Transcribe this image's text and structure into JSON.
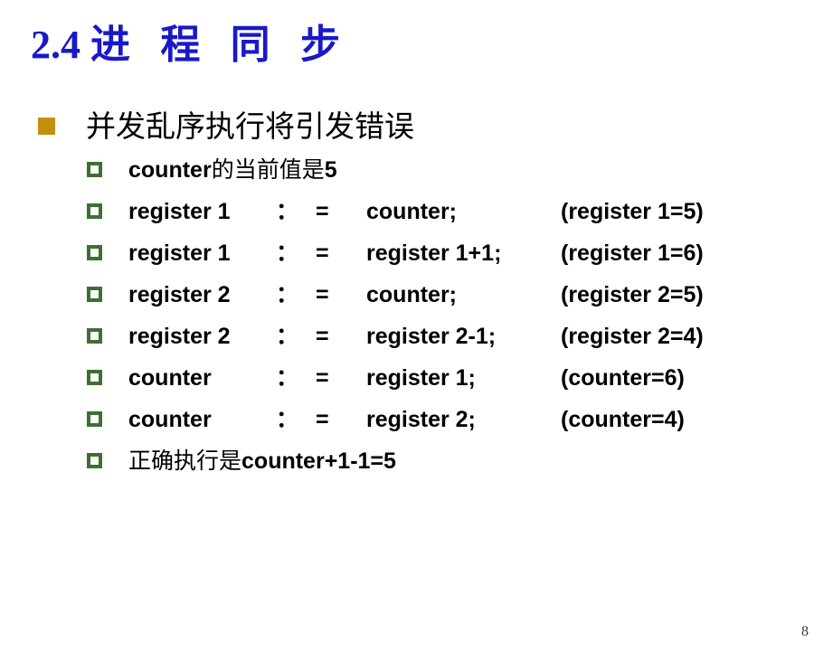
{
  "slide": {
    "title_number": "2.4",
    "title_text": "进 程 同 步",
    "title_color": "#1a19c8",
    "background_color": "#ffffff",
    "page_number": "8"
  },
  "bullets": {
    "level1_marker": "filled-square-bullet",
    "level1_marker_color": "#c2900c",
    "level2_marker": "hollow-square-bullet",
    "level2_marker_color": "#3c7032"
  },
  "content": {
    "heading": "并发乱序执行将引发错误",
    "lines": [
      {
        "kind": "plain",
        "text": "counter的当前值是5",
        "cjk_prefix": "",
        "latin": "counter",
        "cjk": "的当前值是",
        "tail": "5"
      },
      {
        "kind": "assign",
        "lhs": "register 1",
        "colon": "：",
        "eq": "=",
        "rhs": "counter;",
        "note": "(register 1=5)"
      },
      {
        "kind": "assign",
        "lhs": "register 1",
        "colon": "：",
        "eq": "=",
        "rhs": "register 1+1;",
        "note": "(register 1=6)"
      },
      {
        "kind": "assign",
        "lhs": "register 2",
        "colon": "：",
        "eq": "=",
        "rhs": "counter;",
        "note": "(register 2=5)"
      },
      {
        "kind": "assign",
        "lhs": "register 2",
        "colon": "：",
        "eq": "=",
        "rhs": "register 2-1;",
        "note": "(register 2=4)"
      },
      {
        "kind": "assign",
        "lhs": "counter",
        "colon": "：",
        "eq": "=",
        "rhs": "register 1;",
        "note": "(counter=6)"
      },
      {
        "kind": "assign",
        "lhs": "counter",
        "colon": "：",
        "eq": "=",
        "rhs": "register 2;",
        "note": "(counter=4)"
      },
      {
        "kind": "plain",
        "text": "正确执行是counter+1-1=5",
        "cjk": "正确执行是",
        "latin": "counter+1-1=5",
        "tail": ""
      }
    ]
  }
}
